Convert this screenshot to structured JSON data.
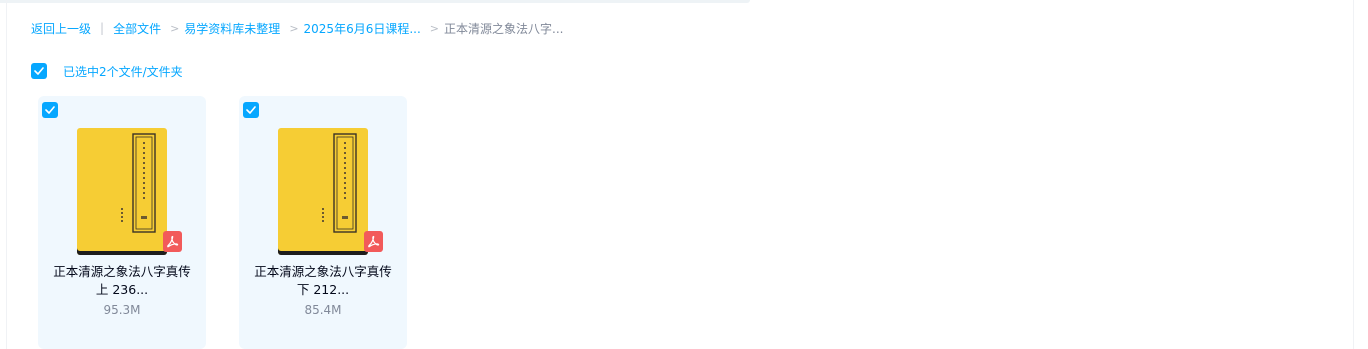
{
  "breadcrumb": {
    "back": "返回上一级",
    "items": [
      "全部文件",
      "易学资料库未整理",
      "2025年6月6日课程...",
      "正本清源之象法八字..."
    ]
  },
  "selection": {
    "text": "已选中2个文件/文件夹",
    "all_checked": true
  },
  "files": [
    {
      "name_line1": "正本清源之象法八字真传",
      "name_line2": "上 236...",
      "size": "95.3M",
      "checked": true,
      "type_icon": "pdf-icon"
    },
    {
      "name_line1": "正本清源之象法八字真传",
      "name_line2": "下 212...",
      "size": "85.4M",
      "checked": true,
      "type_icon": "pdf-icon"
    }
  ],
  "colors": {
    "accent": "#06a7ff",
    "card_bg": "#f0f8fe",
    "book_cover": "#f6cd34",
    "pdf_badge": "#f25a5a"
  }
}
